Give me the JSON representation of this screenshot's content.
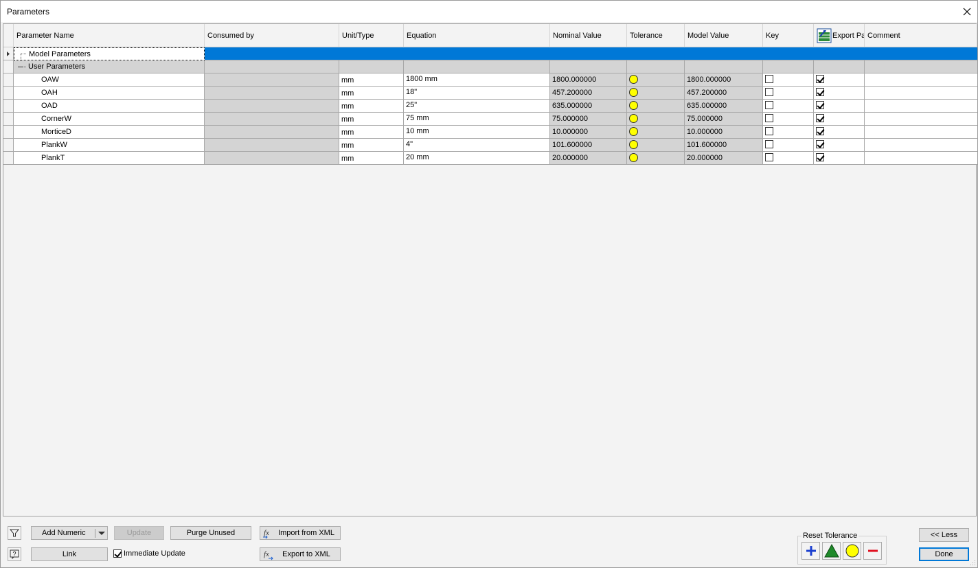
{
  "window": {
    "title": "Parameters"
  },
  "columns": [
    "Parameter Name",
    "Consumed by",
    "Unit/Type",
    "Equation",
    "Nominal Value",
    "Tolerance",
    "Model Value",
    "Key",
    "Export Pa",
    "Comment"
  ],
  "groups": {
    "model": "Model Parameters",
    "user": "User Parameters"
  },
  "parameters": [
    {
      "name": "OAW",
      "unit": "mm",
      "equation": "1800 mm",
      "nominal": "1800.000000",
      "model": "1800.000000",
      "key": false,
      "export": true
    },
    {
      "name": "OAH",
      "unit": "mm",
      "equation": "18\"",
      "nominal": "457.200000",
      "model": "457.200000",
      "key": false,
      "export": true
    },
    {
      "name": "OAD",
      "unit": "mm",
      "equation": "25\"",
      "nominal": "635.000000",
      "model": "635.000000",
      "key": false,
      "export": true
    },
    {
      "name": "CornerW",
      "unit": "mm",
      "equation": "75 mm",
      "nominal": "75.000000",
      "model": "75.000000",
      "key": false,
      "export": true
    },
    {
      "name": "MorticeD",
      "unit": "mm",
      "equation": "10 mm",
      "nominal": "10.000000",
      "model": "10.000000",
      "key": false,
      "export": true
    },
    {
      "name": "PlankW",
      "unit": "mm",
      "equation": "4\"",
      "nominal": "101.600000",
      "model": "101.600000",
      "key": false,
      "export": true
    },
    {
      "name": "PlankT",
      "unit": "mm",
      "equation": "20 mm",
      "nominal": "20.000000",
      "model": "20.000000",
      "key": false,
      "export": true
    }
  ],
  "footer": {
    "add_numeric": "Add Numeric",
    "update": "Update",
    "purge_unused": "Purge Unused",
    "import_xml": "Import from XML",
    "export_xml": "Export to XML",
    "link": "Link",
    "immediate_update": "Immediate Update",
    "immediate_update_checked": true,
    "reset_tolerance": "Reset Tolerance",
    "less": "<< Less",
    "done": "Done"
  },
  "colors": {
    "selection": "#0078d7",
    "tolerance": "#ffff00",
    "plus": "#1b3fcf",
    "triangle": "#1f8a2a",
    "minus": "#e01020"
  }
}
